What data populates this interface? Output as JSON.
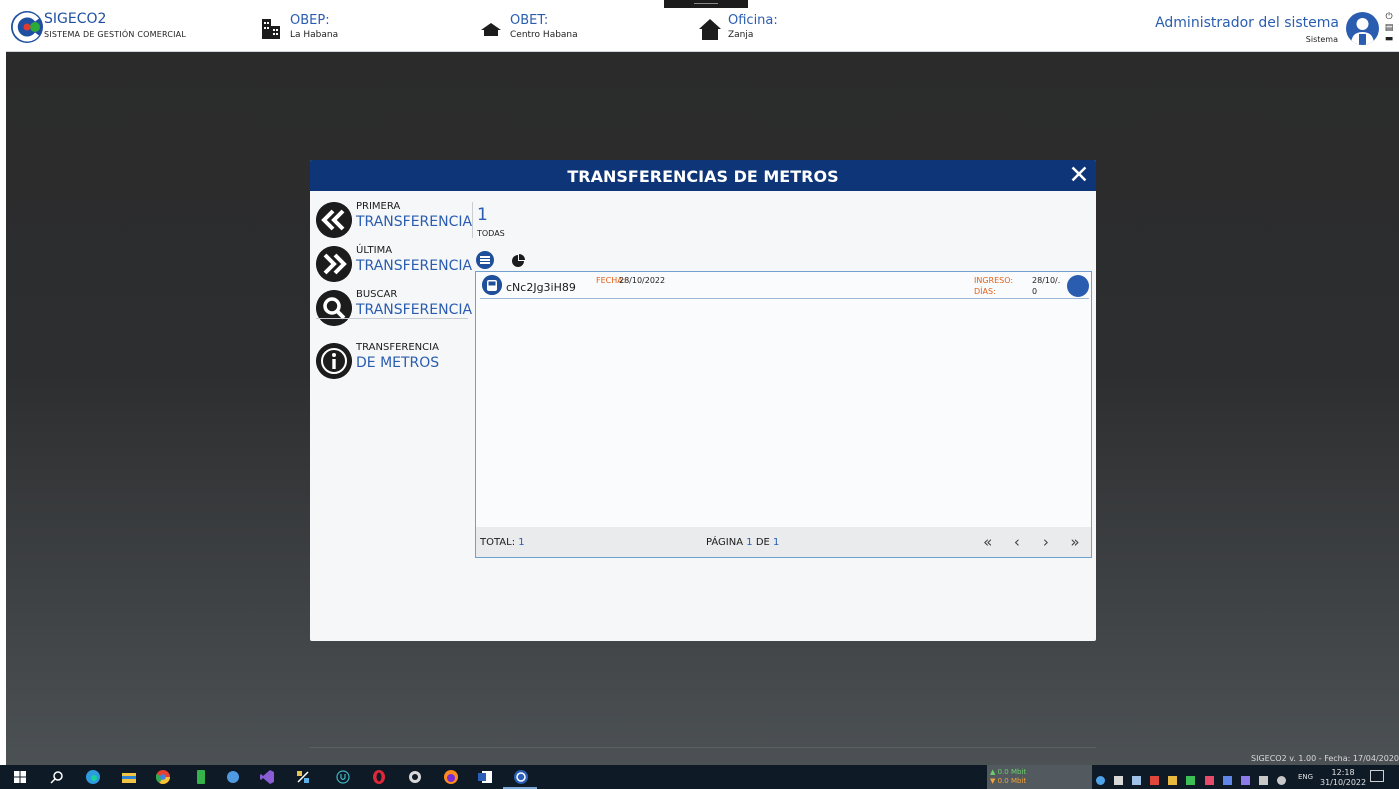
{
  "header": {
    "app_name": "SIGECO2",
    "app_subtitle": "SISTEMA DE GESTIÓN COMERCIAL",
    "obep_label": "OBEP:",
    "obep_value": "La Habana",
    "obet_label": "OBET:",
    "obet_value": "Centro Habana",
    "oficina_label": "Oficina:",
    "oficina_value": "Zanja",
    "user_name": "Administrador del sistema",
    "user_role": "Sistema",
    "icons": [
      "building-icon",
      "roof-icon",
      "house-icon",
      "user-icon",
      "power-icon",
      "calendar-icon",
      "menu-icon"
    ]
  },
  "modal": {
    "title": "TRANSFERENCIAS DE METROS",
    "close_label": "✕",
    "nav": [
      {
        "top": "PRIMERA",
        "bottom": "TRANSFERENCIA",
        "icon": "chevrons-left-icon"
      },
      {
        "top": "ÚLTIMA",
        "bottom": "TRANSFERENCIA",
        "icon": "chevrons-right-icon"
      },
      {
        "top": "BUSCAR",
        "bottom": "TRANSFERENCIA",
        "icon": "search-icon"
      },
      {
        "top": "TRANSFERENCIA",
        "bottom": "DE METROS",
        "icon": "info-icon"
      }
    ],
    "count": "1",
    "count_label": "TODAS",
    "view_icons": [
      "list-view-icon",
      "pie-chart-icon"
    ],
    "rows": [
      {
        "code": "cNc2Jg3iH89",
        "fecha_label": "FECHA:",
        "fecha_value": "28/10/2022",
        "ingreso_label": "INGRESO:",
        "ingreso_value": "28/10/.",
        "dias_label": "DÍAS:",
        "dias_value": "0"
      }
    ],
    "footer": {
      "total_label": "TOTAL:",
      "total_value": "1",
      "page_label": "PÁGINA",
      "page_current": "1",
      "page_of": "DE",
      "page_total": "1",
      "pager": [
        "«",
        "‹",
        "›",
        "»"
      ]
    }
  },
  "version_text": "SIGECO2 v. 1.00 - Fecha: 17/04/2020",
  "taskbar": {
    "net_up": "▲ 0.0 Mbit",
    "net_down": "▼ 0.0 Mbit",
    "language": "ENG",
    "time": "12:18",
    "date": "31/10/2022"
  },
  "colors": {
    "primary": "#0d3578",
    "accent": "#2a5db0",
    "label_orange": "#e2601a"
  }
}
